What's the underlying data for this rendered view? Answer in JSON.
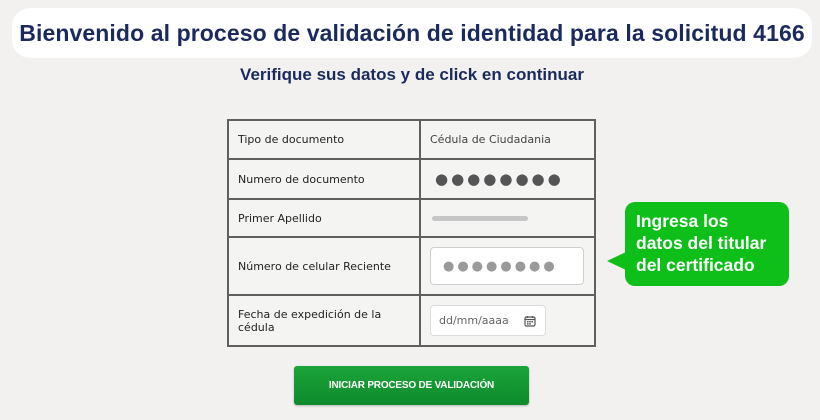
{
  "header": {
    "title": "Bienvenido al proceso de validación de identidad para la solicitud 4166"
  },
  "subtitle": "Verifique sus datos y de click en continuar",
  "form": {
    "rows": [
      {
        "label": "Tipo de documento",
        "value": "Cédula de Ciudadania"
      },
      {
        "label": "Numero de documento",
        "value": "●●●●●●●●"
      },
      {
        "label": "Primer Apellido",
        "value": ""
      },
      {
        "label": "Número de celular Reciente",
        "input_value": "●●●●●●●●"
      },
      {
        "label": "Fecha de expedición de la cédula",
        "input_placeholder": "dd/mm/aaaa",
        "icon": "calendar-icon"
      }
    ]
  },
  "tooltip": {
    "lines": [
      "Ingresa los",
      "datos del titular",
      "del certificado"
    ],
    "color": "#0fbf19"
  },
  "start_button": {
    "label": "INICIAR PROCESO DE VALIDACIÓN",
    "color": "#1ca43a"
  }
}
